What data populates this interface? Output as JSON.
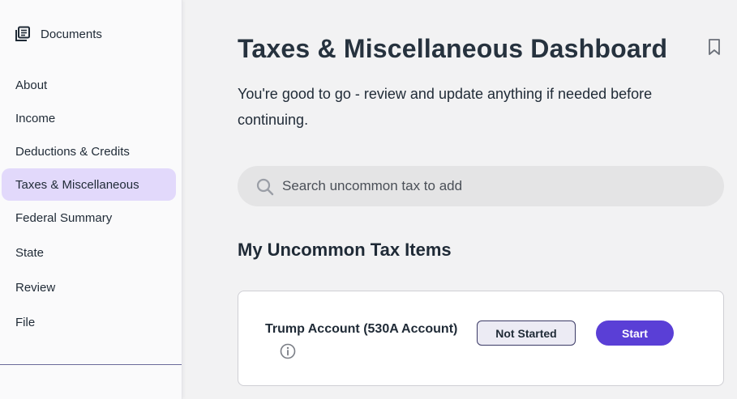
{
  "sidebar": {
    "documents_label": "Documents",
    "items": [
      {
        "label": "About",
        "active": false
      },
      {
        "label": "Income",
        "active": false
      },
      {
        "label": "Deductions & Credits",
        "active": false
      },
      {
        "label": "Taxes & Miscellaneous",
        "active": true
      },
      {
        "label": "Federal Summary",
        "active": false
      },
      {
        "label": "State",
        "active": false
      },
      {
        "label": "Review",
        "active": false
      },
      {
        "label": "File",
        "active": false
      }
    ]
  },
  "main": {
    "title": "Taxes & Miscellaneous Dashboard",
    "subtitle": "You're good to go - review and update anything if needed before continuing.",
    "search": {
      "placeholder": "Search uncommon tax to add",
      "value": ""
    },
    "section_title": "My Uncommon Tax Items",
    "items": [
      {
        "name": "Trump Account (530A Account)",
        "status": "Not Started",
        "action": "Start"
      }
    ]
  },
  "colors": {
    "accent": "#5a3fd6",
    "active_nav_bg": "#e2d9fb",
    "page_bg": "#f2f2f3",
    "sidebar_bg": "#fafafb"
  },
  "icons": {
    "documents": "documents-icon",
    "bookmark": "bookmark-icon",
    "search": "search-icon",
    "info": "info-icon"
  }
}
